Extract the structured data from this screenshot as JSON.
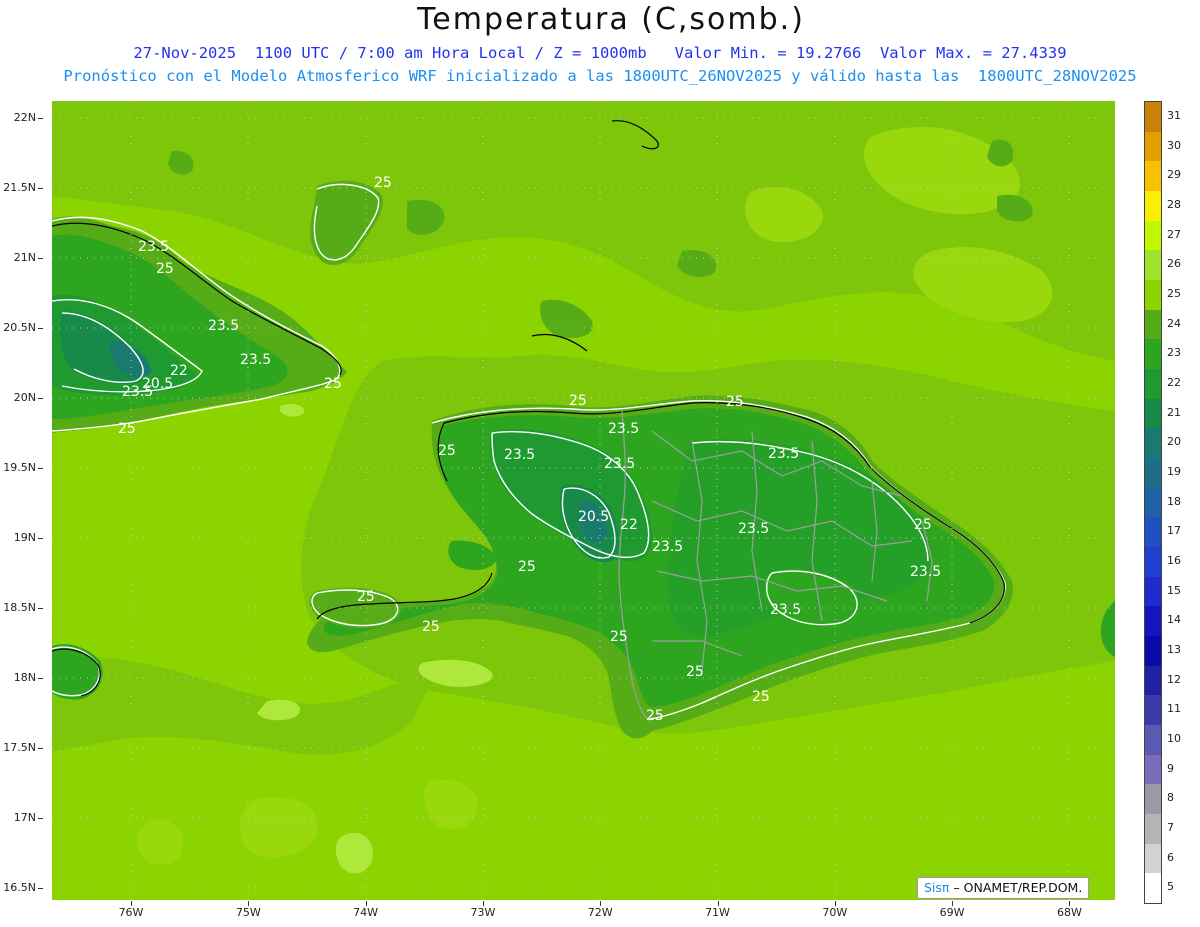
{
  "header": {
    "title": "Temperatura (C,somb.)",
    "line1": "27-Nov-2025  1100 UTC / 7:00 am Hora Local / Z = 1000mb   Valor Min. = 19.2766  Valor Max. = 27.4339",
    "line2": "Pronóstico con el Modelo Atmosferico WRF inicializado a las 1800UTC_26NOV2025 y válido hasta las  1800UTC_28NOV2025"
  },
  "map": {
    "lat_range": [
      17.67,
      22.2
    ],
    "lon_range": [
      -76.65,
      -67.4
    ],
    "lat_labels": [
      "22N",
      "21.5N",
      "21N",
      "20.5N",
      "20N",
      "19.5N",
      "19N",
      "18.5N",
      "18N",
      "17.5N",
      "17N",
      "16.5N"
    ],
    "lon_labels": [
      "76W",
      "75W",
      "74W",
      "73W",
      "72W",
      "71W",
      "70W",
      "69W",
      "68W"
    ],
    "contour_labels": [
      "25",
      "23.5",
      "25",
      "23.5",
      "22",
      "20.5",
      "23.5",
      "25",
      "25",
      "25",
      "23.5",
      "23.5",
      "25",
      "23.5",
      "20.5",
      "22",
      "23.5",
      "23.5",
      "23.5",
      "25",
      "23.5",
      "25",
      "25",
      "25",
      "23.5",
      "25",
      "23.5",
      "25",
      "25",
      "25",
      "25"
    ],
    "shade_colors": {
      "ocean": "#8cd400",
      "t24": "#56ac16",
      "t23": "#2ea51e",
      "t22": "#1e9a30",
      "t21": "#178a4a",
      "t20": "#1a7a70",
      "light": "#aee83a"
    }
  },
  "colorbar": {
    "labels": [
      "31",
      "30",
      "29",
      "28",
      "27",
      "26",
      "25",
      "24",
      "23",
      "22",
      "21",
      "20",
      "19",
      "18",
      "17",
      "16",
      "15",
      "14",
      "13",
      "12",
      "11",
      "10",
      "9",
      "8",
      "7",
      "6",
      "5"
    ],
    "colors": [
      "#c8820a",
      "#e49e00",
      "#f8c000",
      "#f8f000",
      "#c0f800",
      "#a2e22a",
      "#8cd400",
      "#56ac16",
      "#2ea51e",
      "#1e9a30",
      "#178a4a",
      "#1a7a70",
      "#1e6e8a",
      "#1f63a6",
      "#1f52c0",
      "#1f3fd0",
      "#1f2ccc",
      "#1414c0",
      "#0a0aa8",
      "#2020a0",
      "#3a3aaa",
      "#5a5ab4",
      "#7a6cb8",
      "#9a9aa2",
      "#b4b4b4",
      "#d2d2d2",
      "#ffffff"
    ]
  },
  "credit": {
    "brand": "Sisπ",
    "text": "– ONAMET/REP.DOM."
  }
}
